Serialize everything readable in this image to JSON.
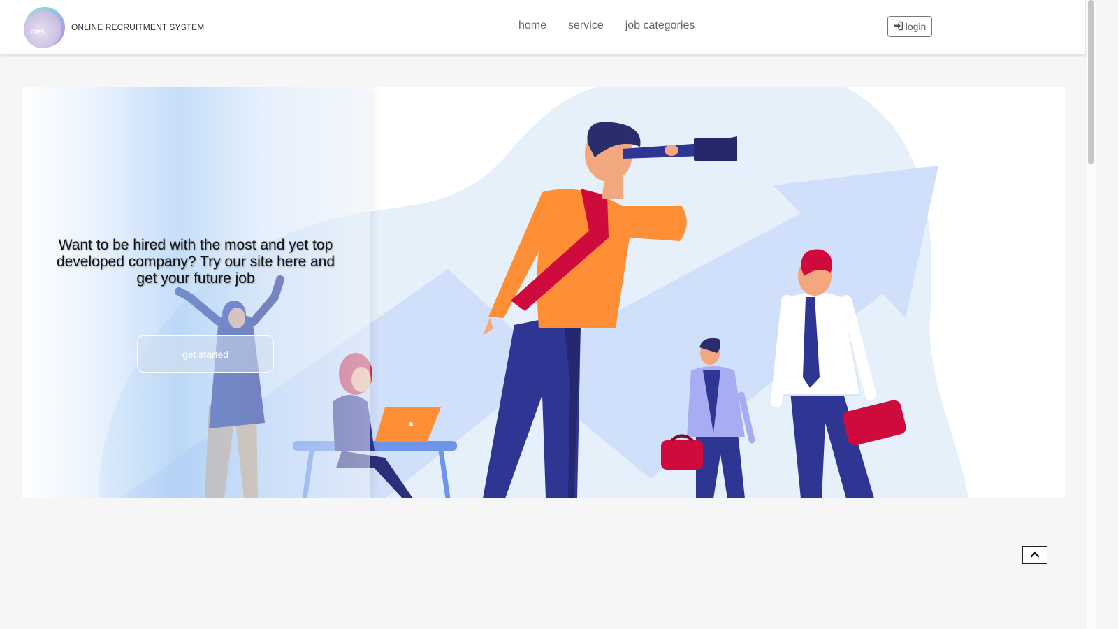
{
  "brand": {
    "logo_text": "ORS",
    "name": "ONLINE RECRUITMENT SYSTEM"
  },
  "nav": {
    "items": [
      "home",
      "service",
      "job categories"
    ]
  },
  "header": {
    "login_label": "login",
    "login_icon": "sign-in-icon"
  },
  "hero": {
    "headline": "Want to be hired with the most and yet top developed company? Try our site here and get your future job",
    "cta_label": "get started",
    "illustration": "people-looking-through-telescope-growth-arrow"
  },
  "back_to_top": {
    "icon": "chevron-up-icon"
  },
  "colors": {
    "accent_orange": "#ff8f36",
    "navy": "#2e3592",
    "tie_red": "#cf0b3e",
    "background": "#f6f6f6"
  }
}
